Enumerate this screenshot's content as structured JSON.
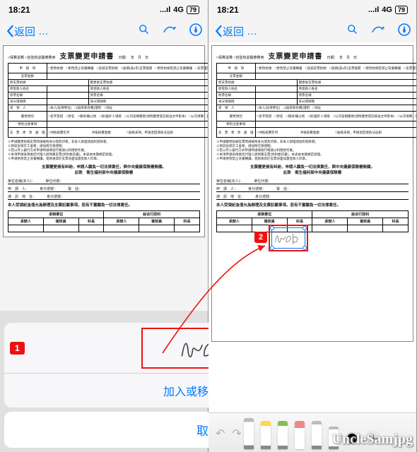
{
  "status": {
    "time": "18:21",
    "network": "4G",
    "signal": "...ıl",
    "battery": "79"
  },
  "nav": {
    "back": "返回",
    "dots": "…"
  },
  "doc": {
    "title": "支票變更申請書",
    "date_labels": "日期：　年　月　日",
    "meta_left": "□保費退費 □自墊核退醫療費用",
    "row_app_label": "申　請　項",
    "row_app_opts": "□更改抬頭　□更改禁止背書轉讓　□註銷支票抬頭　□逾期(滿1年)支票換開　□更改抬頭及禁止背書轉讓　□支票遺失　□其他　□取消禁止背書轉讓(英金額　　元以下)　□延展本人受領",
    "ticket_label": "支票金額",
    "orig_col": "原支票抬頭",
    "chg_col": "變更後支票抬頭",
    "rows": [
      "原受款人姓名",
      "原票名稱",
      "身分證號碼",
      "受　領　人",
      "□本人(投保單位)　□(與受款有關)證明　□地址",
      "變更原因",
      "□名字登錯　□改名　□隨母/繼父姓　□從/國外人領取　□公司名稱變更(須附變更登記核准文件影本)　□公司清算、解散，代表人領取　□轉讓，由OOO名稱領取　□某某代理人申請經審理無訛或依法指定代理　□轉讓他人(附切結書，限領單位)　□其他",
      "特別注意事項",
      "支　票　更　改　處　理",
      "處　理　情　況",
      "□沖抵核實年月　　　　　　　沖抵核實金額　　　　　□逾格未領，申請退回或依法註銷"
    ],
    "notes": [
      "※申請變更抬頭支票時請檢附身分證及印章，非本人辦理須加附受款者。",
      "※目前投保於工會者，請加附在保證明。",
      "※若以存入銀行方式申請時請填寫行帳號以利匯款作業。",
      "※本項申請表限委託代理人辦領重支票(另附委託書)，本表依本期規定辦理。",
      "※申請更改禁止背書轉讓，受款後得於支票背面加蓋受款人印章。"
    ],
    "footer_main": "支票變更倘有糾紛，申請人願負一切法律責任，與中央健康保險署無關。",
    "footer_sub": "此致　衛生福利部中央健康保險署",
    "info_labels": {
      "unit": "單位名稱(本人)：",
      "unitcode": "單位代號：",
      "app": "申　請　人：",
      "id": "身分證號：",
      "phone": "電　話：",
      "addr": "通　訊　地　址：",
      "idno": "身分證號："
    },
    "note_line": "本人受領紀金僅允為辦理及支票記載事項，若有不實願負一切法律責任。",
    "sig_header_left": "承辦單位",
    "sig_header_right": "綜合行政科",
    "sig_cols": [
      "承辦人",
      "複核員",
      "科長",
      "承辦人",
      "複核員",
      "科長"
    ]
  },
  "sheet": {
    "action": "加入或移除簽名檔",
    "cancel": "取消"
  },
  "badges": {
    "one": "1",
    "two": "2"
  },
  "watermark": "UncleSamjpg"
}
